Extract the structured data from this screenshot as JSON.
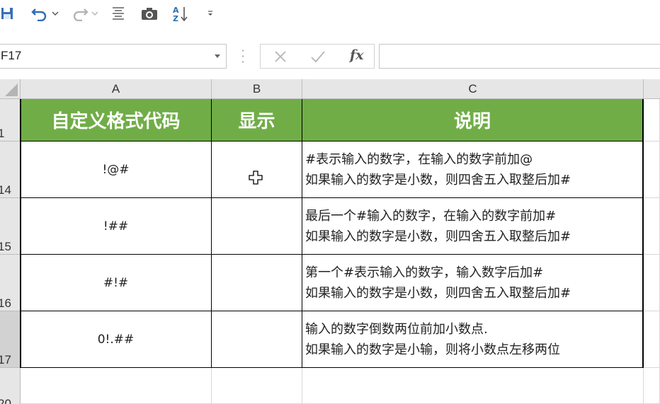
{
  "toolbar": {
    "icons": [
      "save-icon",
      "undo-icon",
      "redo-icon",
      "align-icon",
      "camera-icon",
      "sort-icon",
      "customize-icon"
    ]
  },
  "formula_bar": {
    "name_box": "F17",
    "fx_label": "fx",
    "formula": ""
  },
  "columns": [
    "A",
    "B",
    "C"
  ],
  "rows": [
    "1",
    "14",
    "15",
    "16",
    "17",
    "20"
  ],
  "table": {
    "headers": [
      "自定义格式代码",
      "显示",
      "说明"
    ],
    "rows": [
      {
        "code": "!@#",
        "display": "",
        "note1": "#表示输入的数字，在输入的数字前加@",
        "note2": "如果输入的数字是小数，则四舍五入取整后加#"
      },
      {
        "code": "!##",
        "display": "",
        "note1": "最后一个#输入的数字，在输入的数字前加#",
        "note2": "如果输入的数字是小数，则四舍五入取整后加#"
      },
      {
        "code": "#!#",
        "display": "",
        "note1": "第一个#表示输入的数字，输入数字后加#",
        "note2": "如果输入的数字是小数，则四舍五入取整后加#"
      },
      {
        "code": "0!.##",
        "display": "",
        "note1": "输入的数字倒数两位前加小数点.",
        "note2": "如果输入的数字是小输，则将小数点左移两位"
      }
    ]
  },
  "colors": {
    "header_green": "#70ad47",
    "header_text": "#ffffff"
  }
}
